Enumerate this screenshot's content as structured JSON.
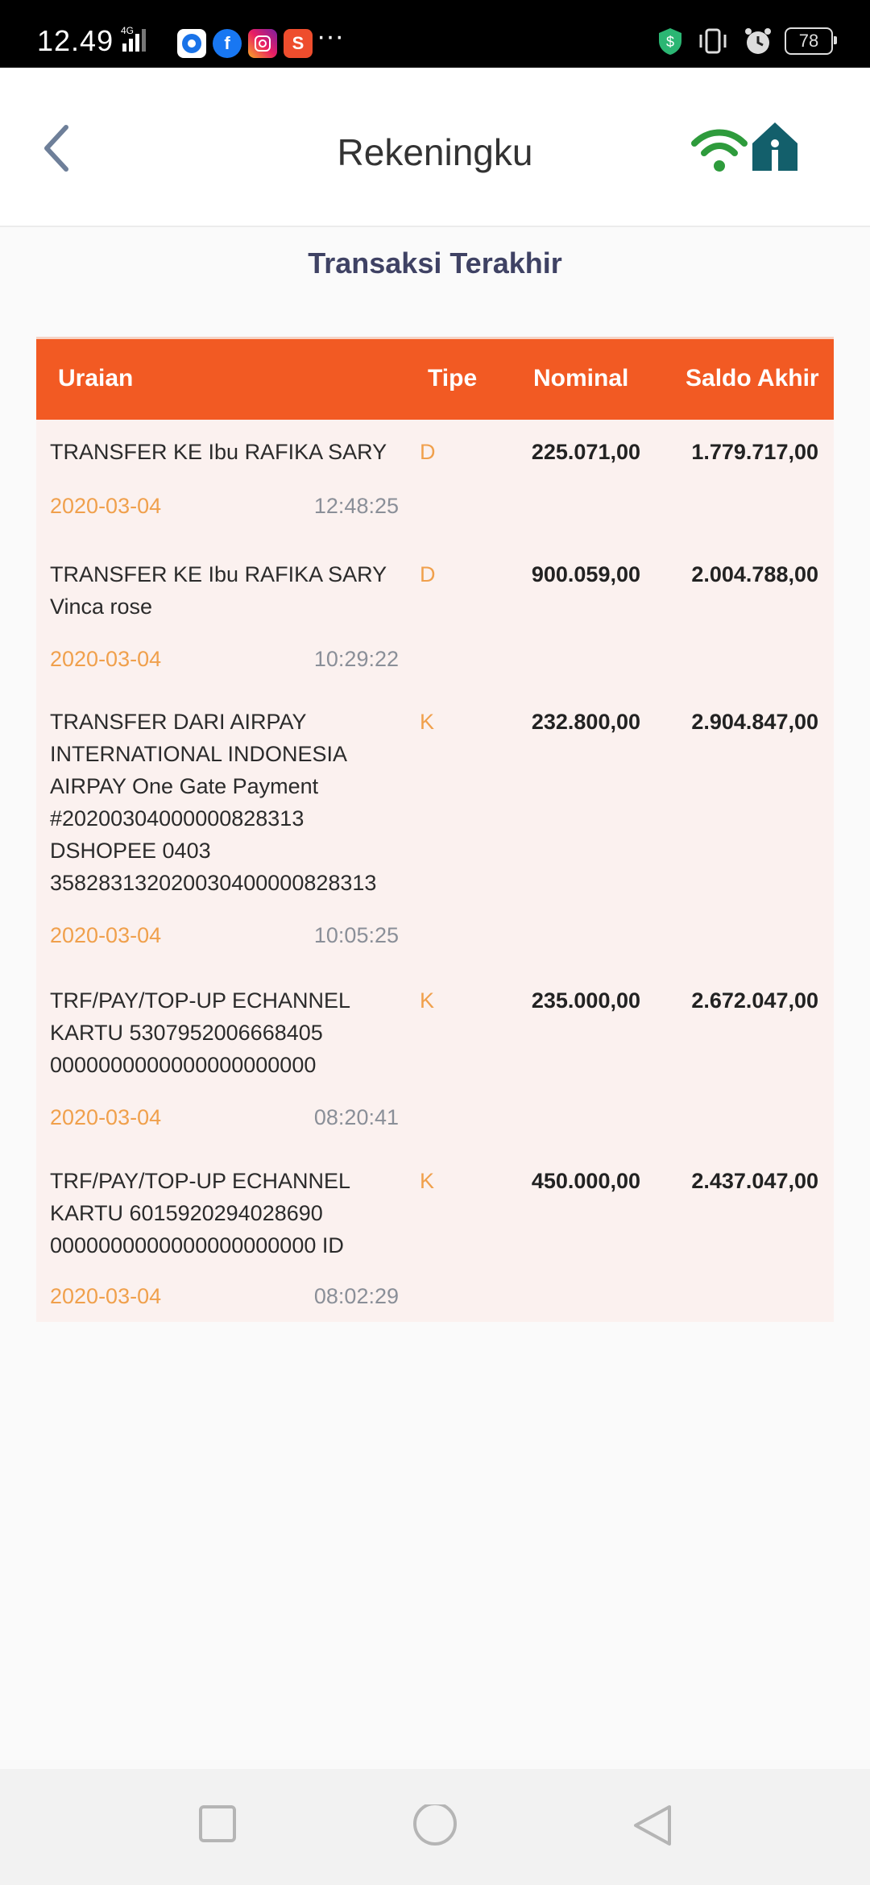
{
  "status_bar": {
    "time": "12.49",
    "network": "4G",
    "battery": "78",
    "more": "···"
  },
  "header": {
    "title": "Rekeningku"
  },
  "section_title": "Transaksi Terakhir",
  "table": {
    "headers": {
      "uraian": "Uraian",
      "tipe": "Tipe",
      "nominal": "Nominal",
      "saldo": "Saldo Akhir"
    },
    "rows": [
      {
        "desc": "TRANSFER KE Ibu RAFIKA SARY",
        "tipe": "D",
        "nominal": "225.071,00",
        "saldo": "1.779.717,00",
        "date": "2020-03-04",
        "time": "12:48:25"
      },
      {
        "desc": "TRANSFER KE Ibu RAFIKA SARY\nVinca rose",
        "tipe": "D",
        "nominal": "900.059,00",
        "saldo": "2.004.788,00",
        "date": "2020-03-04",
        "time": "10:29:22"
      },
      {
        "desc": "TRANSFER DARI AIRPAY\nINTERNATIONAL INDONESIA\nAIRPAY One Gate Payment\n#20200304000000828313\nDSHOPEE 0403\n358283132020030400000828313",
        "tipe": "K",
        "nominal": "232.800,00",
        "saldo": "2.904.847,00",
        "date": "2020-03-04",
        "time": "10:05:25"
      },
      {
        "desc": "TRF/PAY/TOP-UP ECHANNEL\nKARTU 5307952006668405\n0000000000000000000000",
        "tipe": "K",
        "nominal": "235.000,00",
        "saldo": "2.672.047,00",
        "date": "2020-03-04",
        "time": "08:20:41"
      },
      {
        "desc": "TRF/PAY/TOP-UP ECHANNEL\nKARTU 6015920294028690\n0000000000000000000000 ID",
        "tipe": "K",
        "nominal": "450.000,00",
        "saldo": "2.437.047,00",
        "date": "2020-03-04",
        "time": "08:02:29"
      }
    ]
  },
  "colors": {
    "accent": "#f25a23",
    "row_bg": "#fbf1ef",
    "date": "#f0a04c",
    "title": "#3f4264",
    "wifi": "#2e9b3c",
    "home": "#135f6b"
  },
  "icons": {
    "back": "chevron-left-icon",
    "wifi": "wifi-icon",
    "home": "home-icon",
    "nav_recent": "square-icon",
    "nav_home": "circle-icon",
    "nav_back": "triangle-back-icon"
  }
}
